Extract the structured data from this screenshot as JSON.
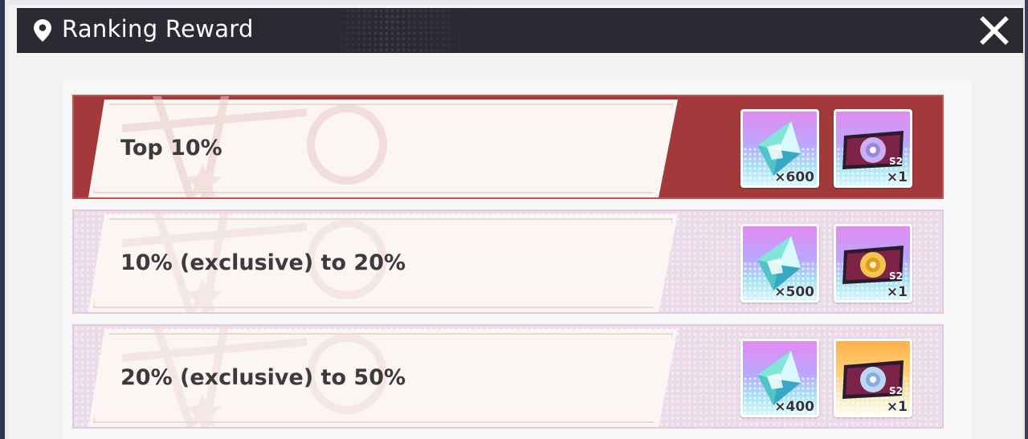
{
  "header": {
    "title": "Ranking Reward",
    "icon": "map-pin-icon",
    "close_icon": "close-icon"
  },
  "colors": {
    "title_bar": "#2b2a33",
    "top_row": "#a23a3b",
    "other_rows": "#ecdbe9",
    "label_text": "#3b3b3b"
  },
  "tiers": [
    {
      "label": "Top 10%",
      "highlighted": true,
      "rewards": [
        {
          "icon": "crystal-gem-icon",
          "quantity": "×600"
        },
        {
          "icon": "s2-ticket-icon",
          "quantity": "×1"
        }
      ]
    },
    {
      "label": "10% (exclusive) to 20%",
      "highlighted": false,
      "rewards": [
        {
          "icon": "crystal-gem-icon",
          "quantity": "×500"
        },
        {
          "icon": "s2-ticket-icon",
          "quantity": "×1"
        }
      ]
    },
    {
      "label": "20% (exclusive) to 50%",
      "highlighted": false,
      "rewards": [
        {
          "icon": "crystal-gem-icon",
          "quantity": "×400"
        },
        {
          "icon": "s2-ticket-icon",
          "quantity": "×1"
        }
      ]
    }
  ]
}
